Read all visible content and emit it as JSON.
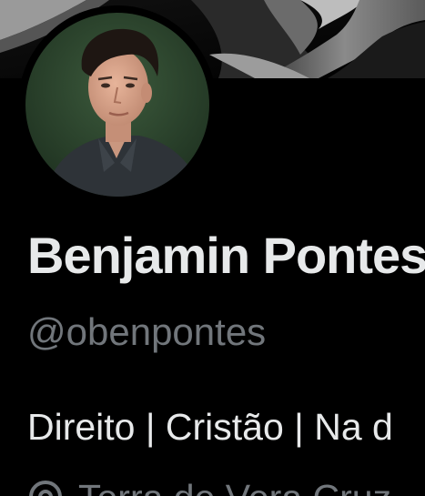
{
  "profile": {
    "display_name": "Benjamin Pontes",
    "handle": "@obenpontes",
    "bio": "Direito | Cristão | Na d",
    "location": "Terra de Vera Cruz"
  },
  "icons": {
    "location": "location-pin-icon"
  },
  "colors": {
    "background": "#000000",
    "primary_text": "#e7e9ea",
    "secondary_text": "#71767b"
  }
}
